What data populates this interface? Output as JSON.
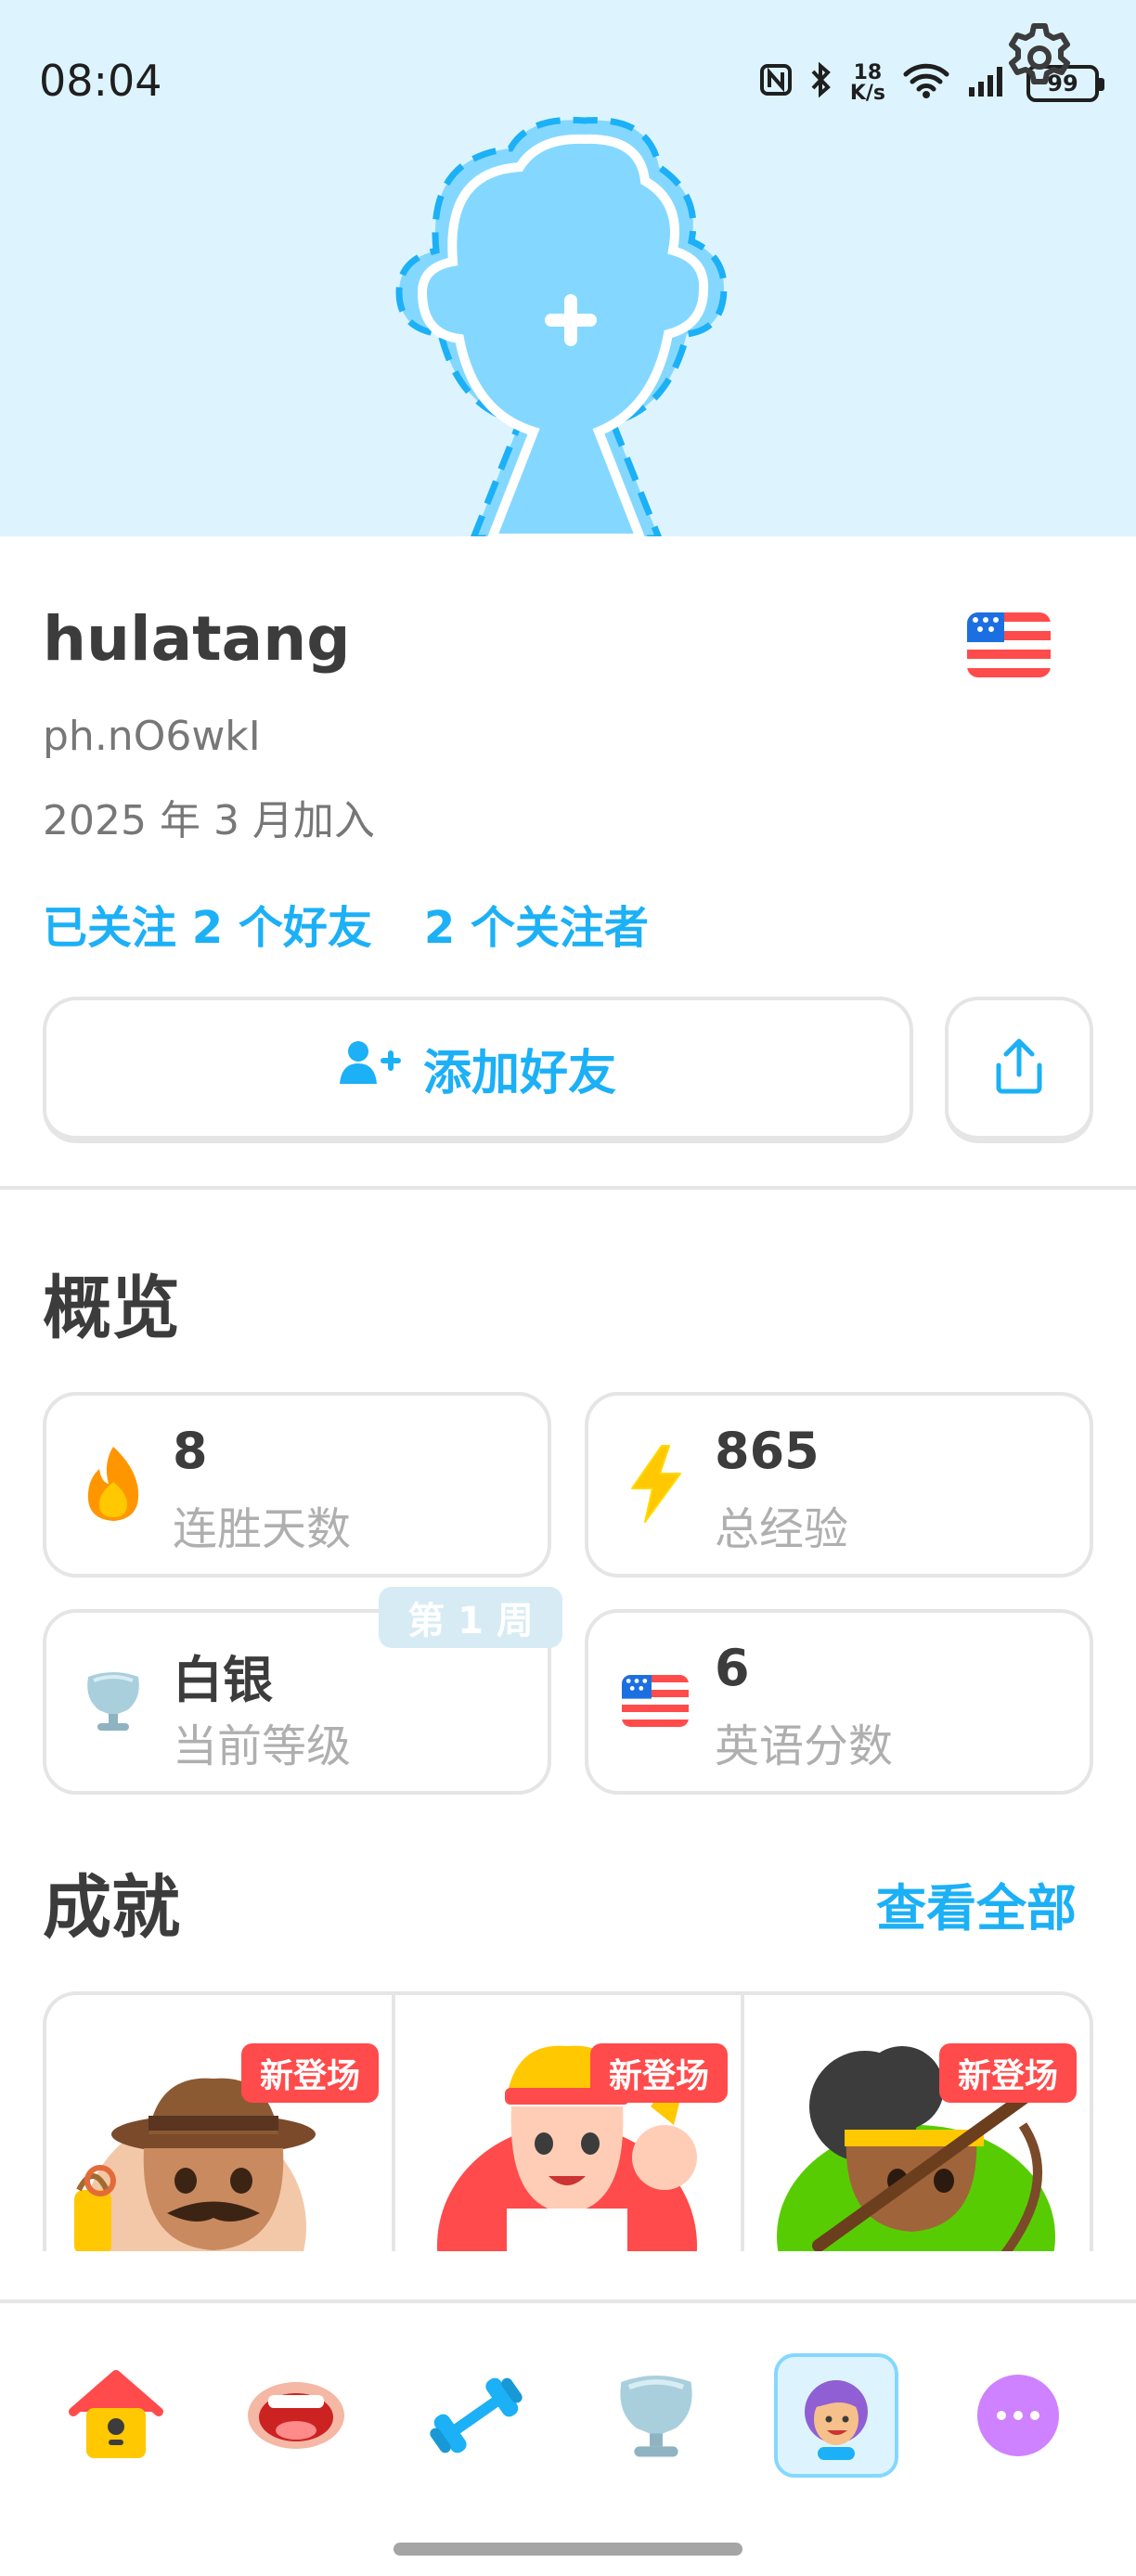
{
  "status_bar": {
    "time": "08:04",
    "net_speed_top": "18",
    "net_speed_bottom": "K/s",
    "battery": "99"
  },
  "profile": {
    "username": "hulatang",
    "handle": "ph.nO6wkI",
    "joined": "2025 年 3 月加入",
    "following": "已关注 2 个好友",
    "followers": "2 个关注者",
    "add_friend_label": "添加好友"
  },
  "overview": {
    "title": "概览",
    "stats": [
      {
        "value": "8",
        "label": "连胜天数",
        "icon": "flame-icon"
      },
      {
        "value": "865",
        "label": "总经验",
        "icon": "lightning-icon"
      },
      {
        "value": "白银",
        "label": "当前等级",
        "icon": "silver-trophy-icon",
        "badge": "第 1 周"
      },
      {
        "value": "6",
        "label": "英语分数",
        "icon": "us-flag-icon"
      }
    ]
  },
  "achievements": {
    "title": "成就",
    "view_all": "查看全部",
    "items": [
      {
        "badge": "新登场",
        "icon": "explorer-character-icon"
      },
      {
        "badge": "新登场",
        "icon": "strongman-character-icon"
      },
      {
        "badge": "新登场",
        "icon": "archer-character-icon"
      }
    ]
  },
  "nav": {
    "items": [
      "home-icon",
      "speak-icon",
      "practice-icon",
      "leagues-icon",
      "profile-icon",
      "more-icon"
    ],
    "active": "profile-icon"
  },
  "colors": {
    "accent": "#1cb0f6",
    "header_bg": "#ddf4ff",
    "badge_red": "#ff4b4b",
    "streak": "#ff9600",
    "xp": "#ffc800"
  }
}
